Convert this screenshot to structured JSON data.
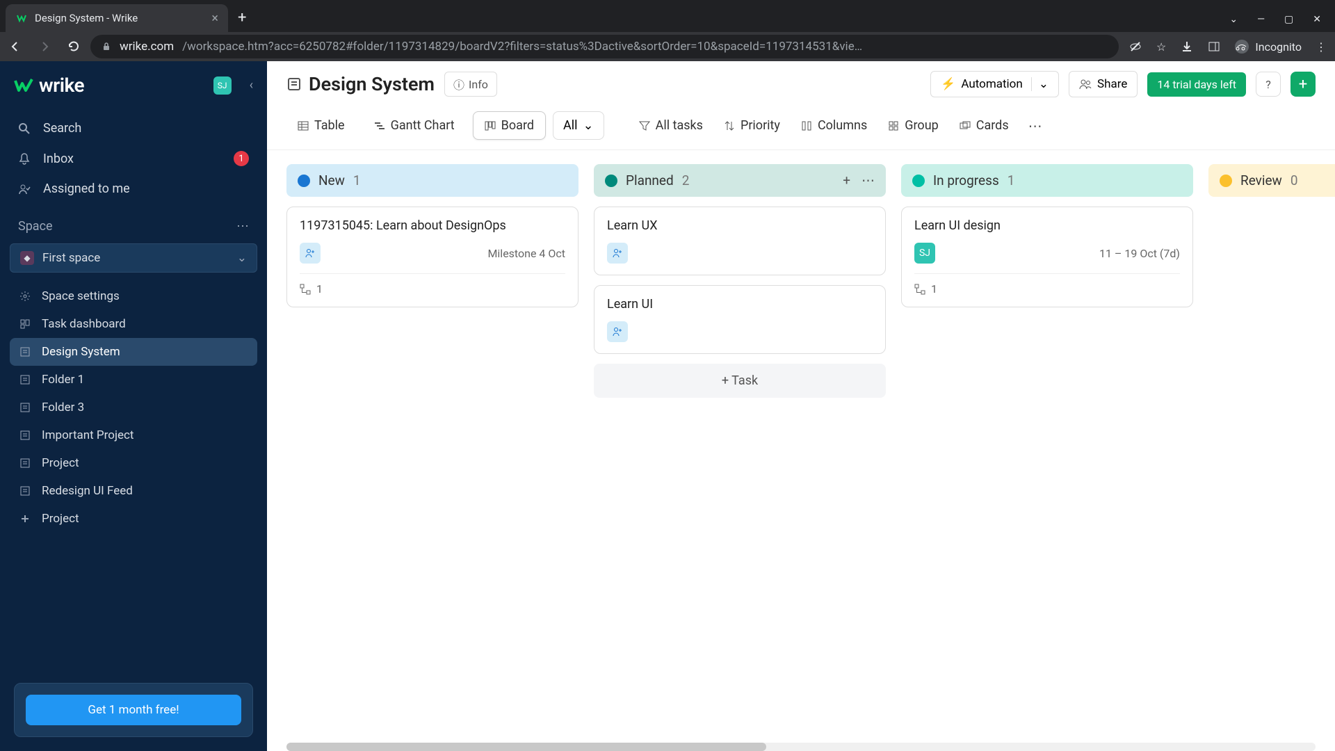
{
  "browser": {
    "tab_title": "Design System - Wrike",
    "url_domain": "wrike.com",
    "url_path": "/workspace.htm?acc=6250782#folder/1197314829/boardV2?filters=status%3Dactive&sortOrder=10&spaceId=1197314531&vie…",
    "incognito": "Incognito"
  },
  "sidebar": {
    "logo": "wrike",
    "avatar": "SJ",
    "nav": {
      "search": "Search",
      "inbox": "Inbox",
      "inbox_badge": "1",
      "assigned": "Assigned to me"
    },
    "space_label": "Space",
    "space_name": "First space",
    "tree": [
      {
        "label": "Space settings",
        "icon": "gear"
      },
      {
        "label": "Task dashboard",
        "icon": "dashboard"
      },
      {
        "label": "Design System",
        "icon": "list",
        "active": true
      },
      {
        "label": "Folder 1",
        "icon": "list"
      },
      {
        "label": "Folder 3",
        "icon": "list"
      },
      {
        "label": "Important Project",
        "icon": "list"
      },
      {
        "label": "Project",
        "icon": "list"
      },
      {
        "label": "Redesign UI Feed",
        "icon": "list"
      },
      {
        "label": "Project",
        "icon": "plus"
      }
    ],
    "promo_button": "Get 1 month free!"
  },
  "header": {
    "title": "Design System",
    "info": "Info",
    "automation": "Automation",
    "share": "Share",
    "trial": "14 trial days left"
  },
  "views": {
    "table": "Table",
    "gantt": "Gantt Chart",
    "board": "Board",
    "all": "All"
  },
  "toolbar": {
    "all_tasks": "All tasks",
    "priority": "Priority",
    "columns": "Columns",
    "group": "Group",
    "cards": "Cards"
  },
  "board": {
    "columns": [
      {
        "key": "new",
        "label": "New",
        "count": "1",
        "cards": [
          {
            "title": "1197315045: Learn about DesignOps",
            "assignee": "add",
            "date": "Milestone 4 Oct",
            "subtasks": "1"
          }
        ]
      },
      {
        "key": "planned",
        "label": "Planned",
        "count": "2",
        "hover": true,
        "cards": [
          {
            "title": "Learn UX",
            "assignee": "add"
          },
          {
            "title": "Learn UI",
            "assignee": "add"
          }
        ],
        "add_task": "+ Task"
      },
      {
        "key": "progress",
        "label": "In progress",
        "count": "1",
        "cards": [
          {
            "title": "Learn UI design",
            "assignee": "SJ",
            "date": "11 – 19 Oct (7d)",
            "subtasks": "1"
          }
        ]
      },
      {
        "key": "review",
        "label": "Review",
        "count": "0",
        "cards": []
      }
    ]
  }
}
